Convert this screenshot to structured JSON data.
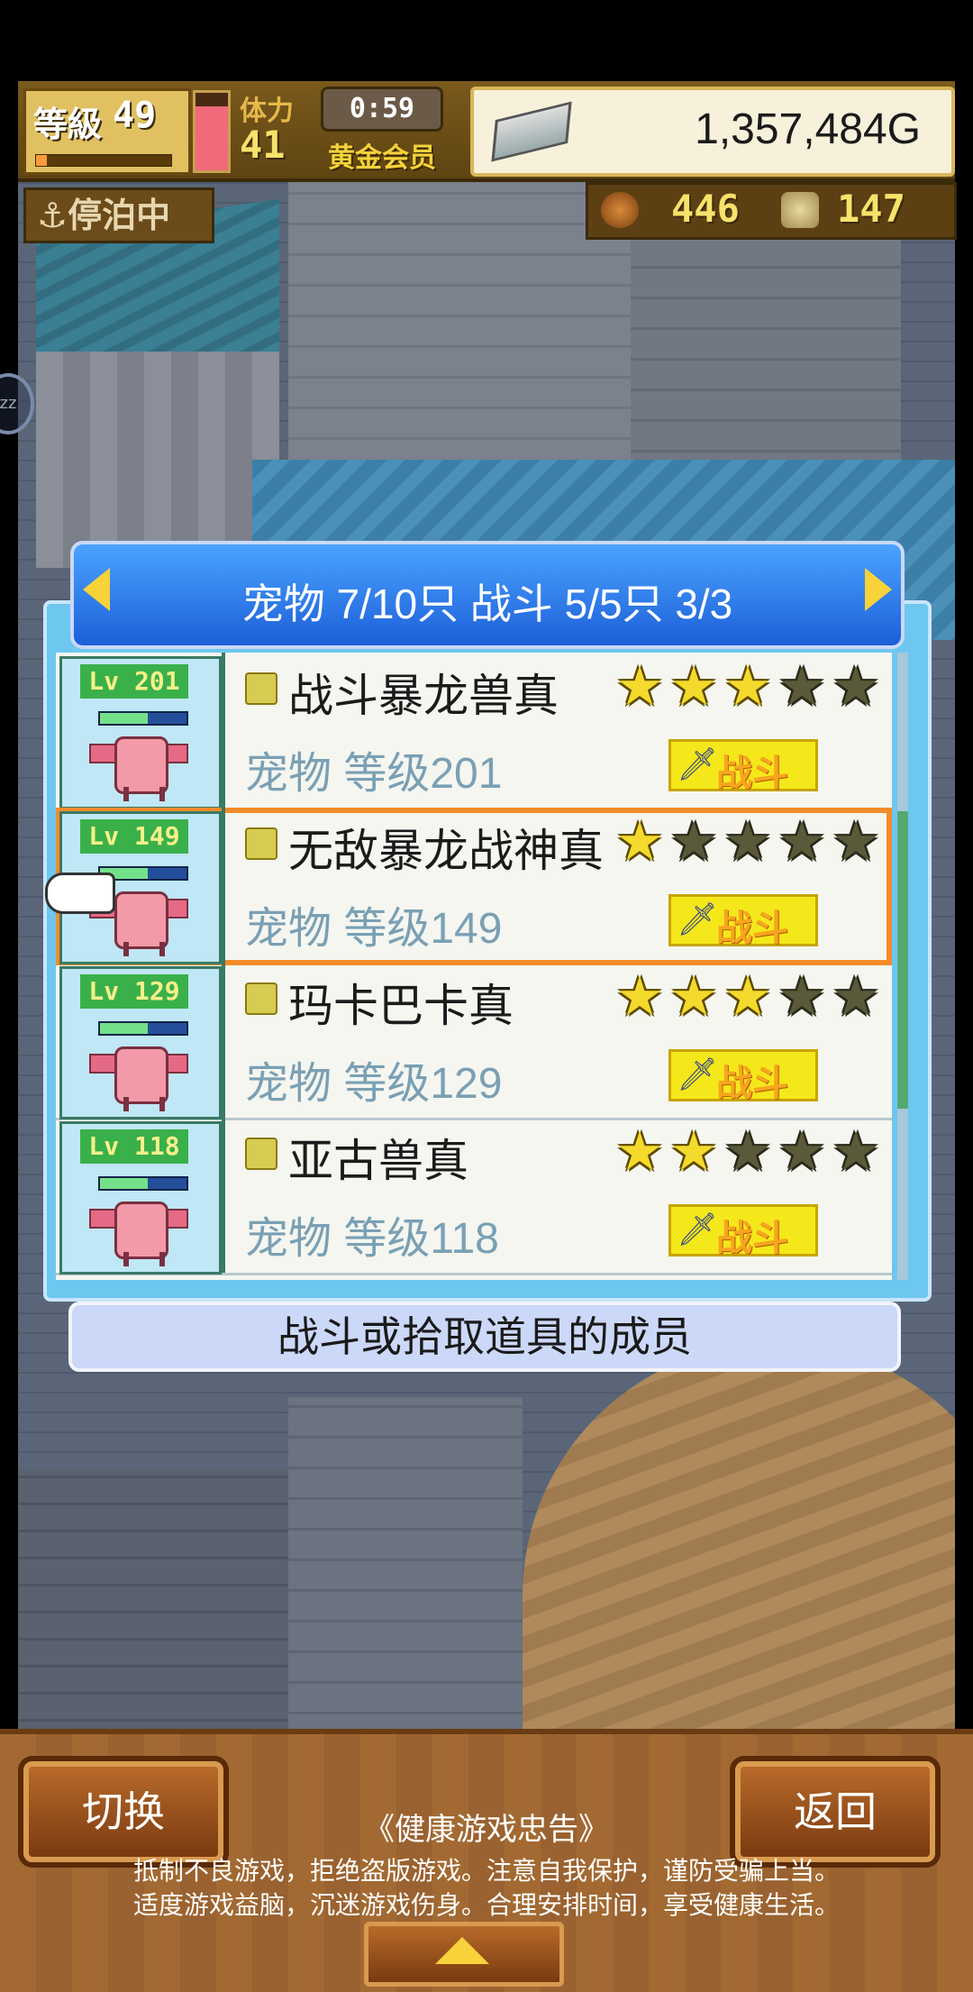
{
  "hud": {
    "level_label": "等級",
    "level_value": "49",
    "level_progress": 0.08,
    "stamina_label": "体力",
    "stamina_value": "41",
    "stamina_fill": 0.82,
    "timer": "0:59",
    "membership": "黄金会员",
    "money": "1,357,484G"
  },
  "status": {
    "dock_badge": "⚓停泊中",
    "resource_a": "446",
    "resource_b": "147",
    "side_dot": "zz"
  },
  "panel": {
    "title": "宠物 7/10只 战斗 5/5只  3/3",
    "footer": "战斗或拾取道具的成员",
    "rows": [
      {
        "level_badge": "Lv 201",
        "name": "战斗暴龙兽真",
        "subtitle": "宠物 等级201",
        "stars": 3,
        "action": "战斗",
        "hp": 0.55
      },
      {
        "level_badge": "Lv 149",
        "name": "无敌暴龙战神真",
        "subtitle": "宠物 等级149",
        "stars": 1,
        "action": "战斗",
        "hp": 0.55,
        "selected": true
      },
      {
        "level_badge": "Lv 129",
        "name": "玛卡巴卡真",
        "subtitle": "宠物 等级129",
        "stars": 3,
        "action": "战斗",
        "hp": 0.55
      },
      {
        "level_badge": "Lv 118",
        "name": "亚古兽真",
        "subtitle": "宠物 等级118",
        "stars": 2,
        "action": "战斗",
        "hp": 0.55
      }
    ]
  },
  "bottom": {
    "switch_label": "切换",
    "back_label": "返回",
    "advice_title": "《健康游戏忠告》",
    "advice_line1": "抵制不良游戏，拒绝盗版游戏。注意自我保护，谨防受骗上当。",
    "advice_line2": "适度游戏益脑，沉迷游戏伤身。合理安排时间，享受健康生活。"
  },
  "colors": {
    "header_blue": "#1d5fd8",
    "selection_orange": "#f48c2a",
    "star_gold": "#f4da2c",
    "battle_yellow": "#f4e81a"
  }
}
